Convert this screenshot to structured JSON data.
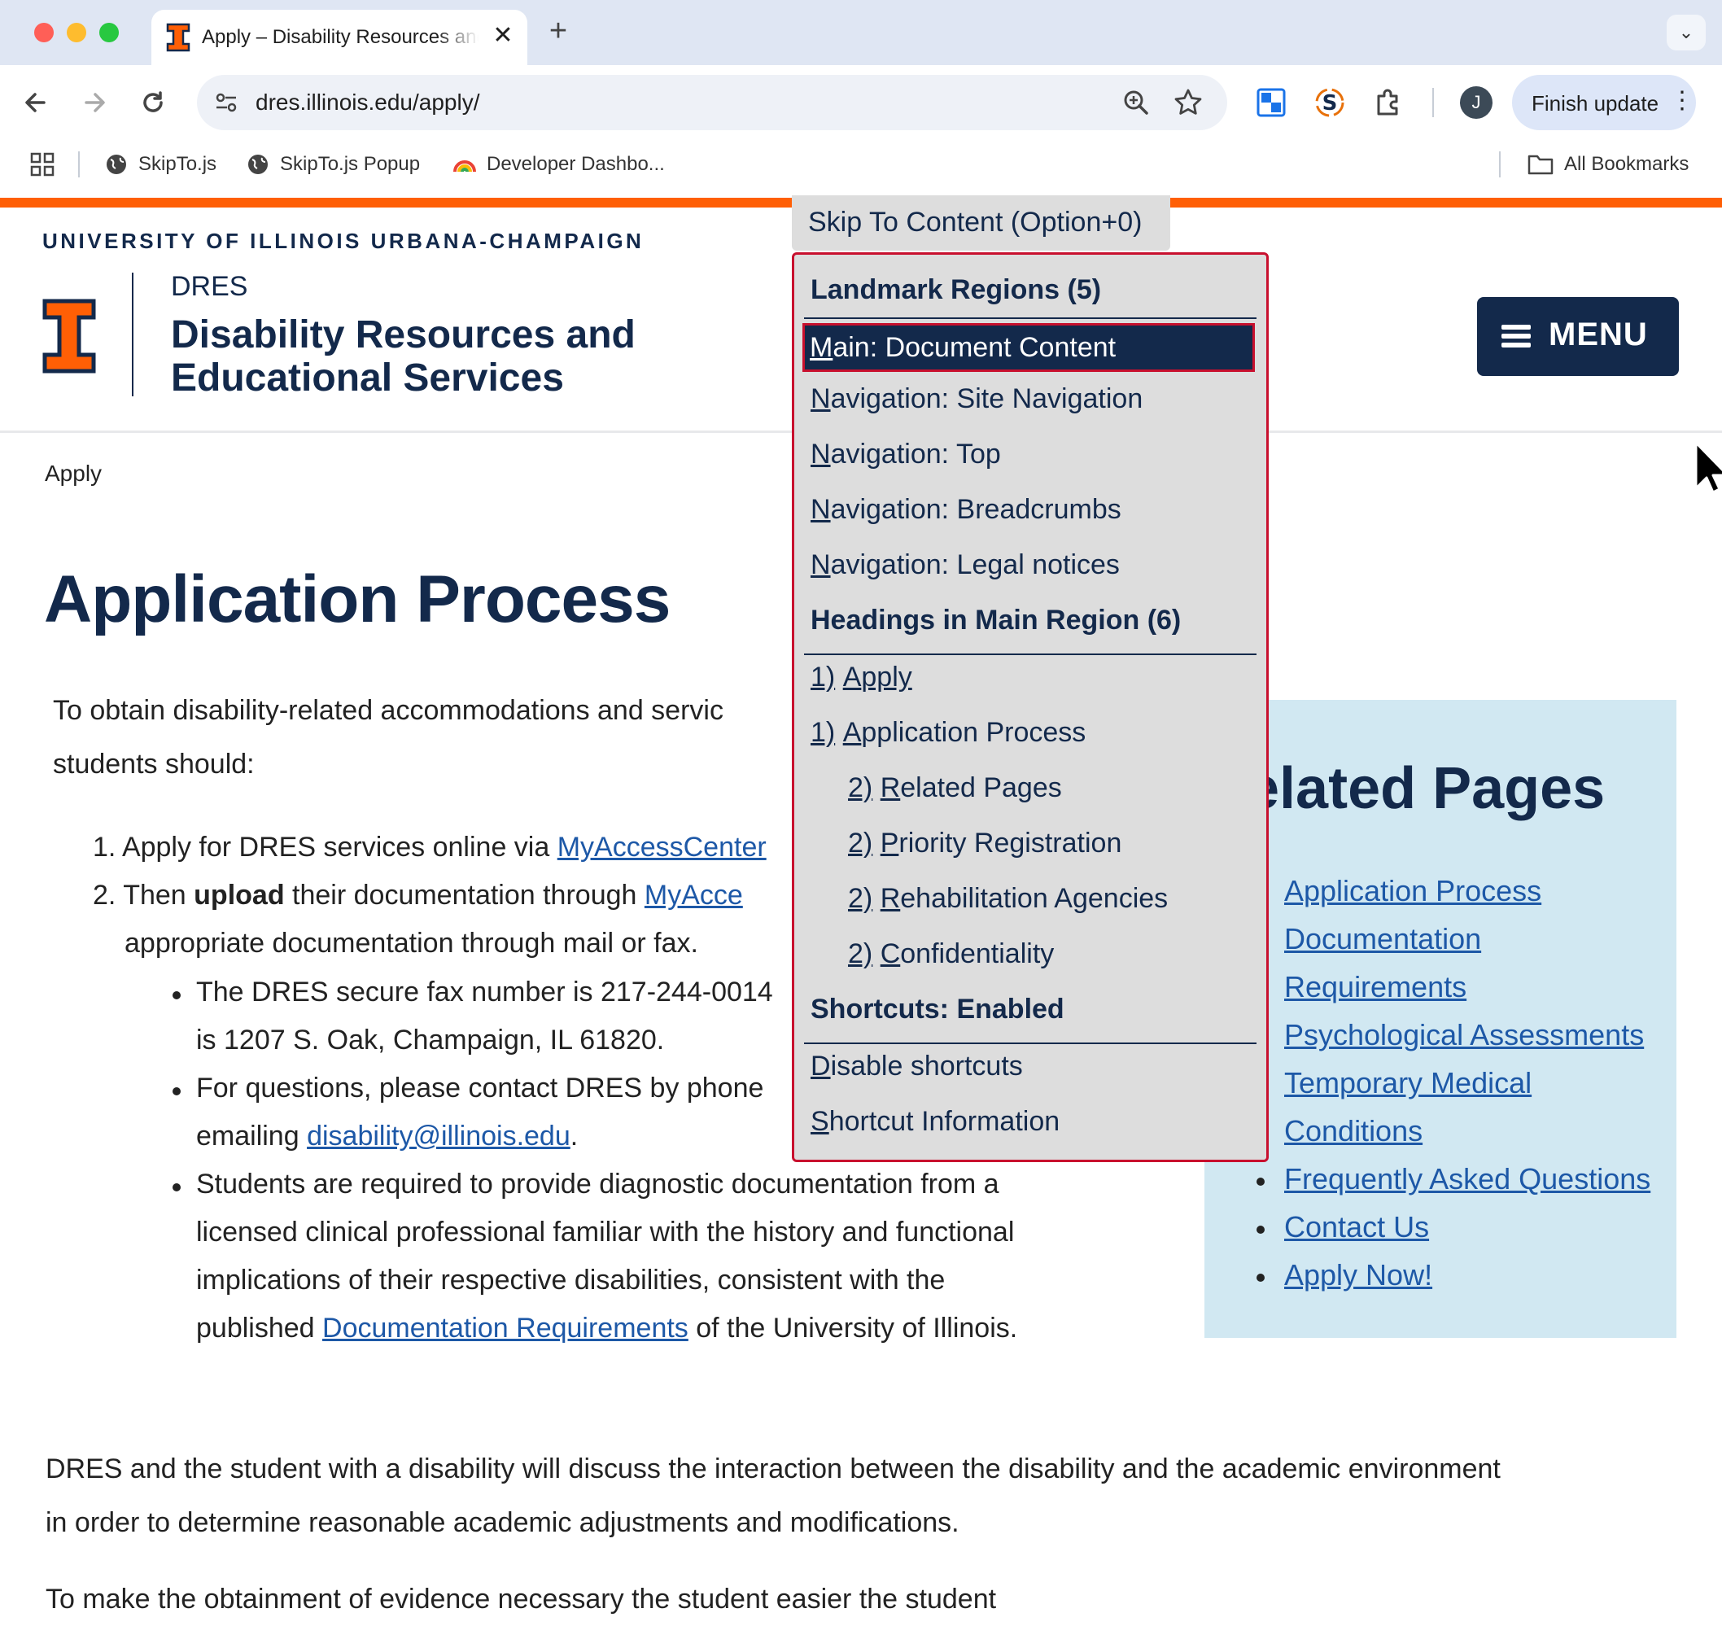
{
  "browser": {
    "tab": {
      "title": "Apply – Disability Resources and Educational Services"
    },
    "url": "dres.illinois.edu/apply/",
    "finish_update_label": "Finish update",
    "profile_initial": "J",
    "bookmarks": [
      "SkipTo.js",
      "SkipTo.js Popup",
      "Developer Dashbo..."
    ],
    "all_bookmarks_label": "All Bookmarks"
  },
  "header": {
    "university": "UNIVERSITY OF ILLINOIS URBANA-CHAMPAIGN",
    "unit_short": "DRES",
    "unit_title_line1": "Disability Resources and",
    "unit_title_line2": "Educational Services",
    "menu_label": "MENU"
  },
  "breadcrumb": "Apply",
  "main": {
    "title": "Application Process",
    "intro_part1": "To obtain disability-related accommodations and servic",
    "intro_part2": "students should:",
    "step1_num": "1.",
    "step1_text": "Apply for DRES services online via ",
    "step1_link": "MyAccessCenter",
    "step2_num": "2.",
    "step2_text_a": "Then ",
    "step2_bold": "upload",
    "step2_text_b": " their documentation through ",
    "step2_link": "MyAcce",
    "step2_line2": "appropriate documentation through mail or fax.",
    "bullet1_line1": "The DRES secure fax number is 217-244-0014",
    "bullet1_line2": "is 1207 S. Oak, Champaign, IL 61820.",
    "bullet2_line1": "For questions, please contact DRES by phone",
    "bullet2_line2_text": "emailing ",
    "bullet2_link": "disability@illinois.edu",
    "bullet2_end": ".",
    "bullet3_line1": "Students are required to provide diagnostic documentation from a",
    "bullet3_line2": "licensed clinical professional familiar with the history and functional",
    "bullet3_line3": "implications of their respective disabilities, consistent with the",
    "bullet3_line4_text": "published ",
    "bullet3_link": "Documentation Requirements",
    "bullet3_line4_end": " of the University of Illinois.",
    "para2_line1": "DRES and the student with a disability will discuss the interaction between the disability and the academic environment",
    "para2_line2": "in order to determine reasonable academic adjustments and modifications.",
    "para3_partial": "To make the obtainment of evidence necessary the student easier the student"
  },
  "related": {
    "title": "Related Pages",
    "links": [
      "Application Process",
      "Documentation",
      "Requirements",
      "Psychological Assessments",
      "Temporary Medical",
      "Conditions",
      "Frequently Asked Questions",
      "Contact Us",
      "Apply Now!"
    ]
  },
  "skipto": {
    "button_label": "Skip To Content (Option+0)",
    "landmarks_heading": "Landmark Regions (5)",
    "landmarks": [
      {
        "key": "M",
        "rest": "ain: Document Content"
      },
      {
        "key": "N",
        "rest": "avigation: Site Navigation"
      },
      {
        "key": "N",
        "rest": "avigation: Top"
      },
      {
        "key": "N",
        "rest": "avigation: Breadcrumbs"
      },
      {
        "key": "N",
        "rest": "avigation: Legal notices"
      }
    ],
    "headings_heading": "Headings in Main Region (6)",
    "headings": [
      {
        "level": "1)",
        "key": "A",
        "rest": "pply"
      },
      {
        "level": "1)",
        "key": "A",
        "rest": "pplication Process"
      },
      {
        "level": "2)",
        "key": "R",
        "rest": "elated Pages"
      },
      {
        "level": "2)",
        "key": "P",
        "rest": "riority Registration"
      },
      {
        "level": "2)",
        "key": "R",
        "rest": "ehabilitation Agencies"
      },
      {
        "level": "2)",
        "key": "C",
        "rest": "onfidentiality"
      }
    ],
    "shortcuts_heading": "Shortcuts: Enabled",
    "shortcut_items": [
      {
        "key": "D",
        "rest": "isable shortcuts"
      },
      {
        "key": "S",
        "rest": "hortcut Information"
      }
    ]
  },
  "colors": {
    "illinois_orange": "#FF5F05",
    "illinois_blue": "#13294B",
    "skipto_focus_border": "#C8102E",
    "related_bg": "#D1E8F2"
  }
}
